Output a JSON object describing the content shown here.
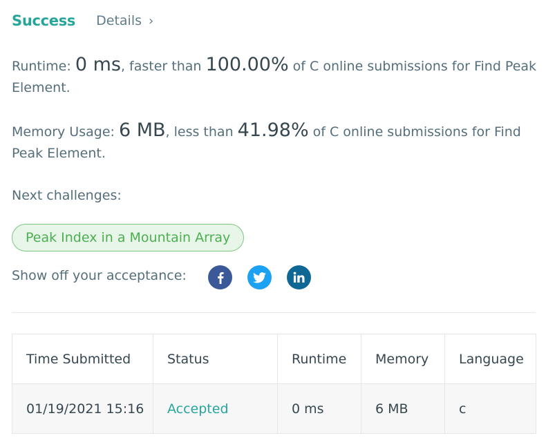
{
  "header": {
    "status": "Success",
    "details_label": "Details",
    "chevron": "›"
  },
  "runtime": {
    "label": "Runtime: ",
    "value": "0 ms",
    "mid": ", faster than ",
    "percent": "100.00%",
    "suffix": " of C online submissions for Find Peak Element."
  },
  "memory": {
    "label": "Memory Usage: ",
    "value": "6 MB",
    "mid": ", less than ",
    "percent": "41.98%",
    "suffix": " of C online submissions for Find Peak Element."
  },
  "next": {
    "label": "Next challenges:",
    "challenges": [
      "Peak Index in a Mountain Array"
    ]
  },
  "share": {
    "label": "Show off your acceptance:",
    "icons": [
      "facebook-icon",
      "twitter-icon",
      "linkedin-icon"
    ],
    "colors": {
      "facebook": "#3b5998",
      "twitter": "#1da1f2",
      "linkedin": "#0e6795"
    }
  },
  "table": {
    "headers": [
      "Time Submitted",
      "Status",
      "Runtime",
      "Memory",
      "Language"
    ],
    "rows": [
      [
        "01/19/2021 15:16",
        "Accepted",
        "0 ms",
        "6 MB",
        "c"
      ]
    ]
  },
  "colors": {
    "accent": "#26a69a",
    "pill_text": "#4caf50",
    "pill_bg": "#e8f5e9"
  }
}
